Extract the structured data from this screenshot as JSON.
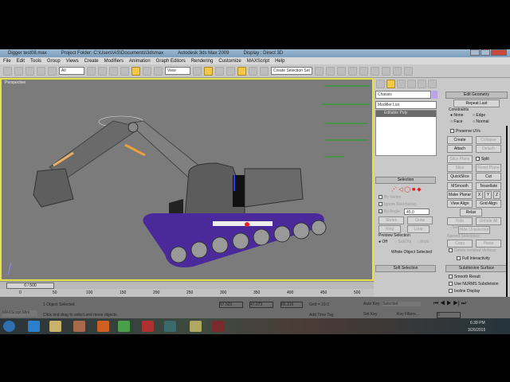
{
  "title": {
    "file": "Digger test08.max",
    "project": "Project Folder: C:\\Users\\AS\\Documents\\3dsmax",
    "app": "Autodesk 3ds Max 2009",
    "display": "Display : Direct 3D"
  },
  "menu": [
    "File",
    "Edit",
    "Tools",
    "Group",
    "Views",
    "Create",
    "Modifiers",
    "Animation",
    "Graph Editors",
    "Rendering",
    "Customize",
    "MAXScript",
    "Help"
  ],
  "toolbar": {
    "filter": "All",
    "refcoord": "View",
    "selset": "Create Selection Set"
  },
  "viewport": {
    "label": "Perspective"
  },
  "panel": {
    "object_name": "Chassis",
    "modifier_list": "Modifier List",
    "stack_item": "Editable Poly",
    "edit_geometry": "Edit Geometry",
    "repeat_last": "Repeat Last",
    "constraints": "Constraints",
    "c_none": "None",
    "c_edge": "Edge",
    "c_face": "Face",
    "c_normal": "Normal",
    "preserve_uvs": "Preserve UVs",
    "create": "Create",
    "collapse": "Collapse",
    "attach": "Attach",
    "detach": "Detach",
    "slice_plane": "Slice Plane",
    "split": "Split",
    "slice": "Slice",
    "reset_plane": "Reset Plane",
    "quickslice": "QuickSlice",
    "cut": "Cut",
    "msmooth": "MSmooth",
    "tessellate": "Tessellate",
    "make_planar": "Make Planar",
    "x": "X",
    "y": "Y",
    "z": "Z",
    "view_align": "View Align",
    "grid_align": "Grid Align",
    "relax": "Relax",
    "hide_selected": "Hide Selected",
    "unhide_all": "Unhide All",
    "hide_unselected": "Hide Unselected",
    "named_selections": "Named Selections:",
    "copy": "Copy",
    "paste": "Paste",
    "delete_isolated": "Delete Isolated Vertices",
    "full_interactivity": "Full Interactivity",
    "subdivision_surface": "Subdivision Surface",
    "smooth_result": "Smooth Result",
    "use_nurms": "Use NURMS Subdivision",
    "isoline_display": "Isoline Display",
    "selection": "Selection",
    "by_vertex": "By Vertex",
    "ignore_backfacing": "Ignore Backfacing",
    "by_angle": "By Angle:",
    "angle_val": "45.0",
    "shrink": "Shrink",
    "grow": "Grow",
    "ring": "Ring",
    "loop": "Loop",
    "preview_selection": "Preview Selection",
    "p_off": "Off",
    "p_subobj": "SubObj",
    "p_multi": "Multi",
    "whole_object": "Whole Object Selected",
    "soft_selection": "Soft Selection"
  },
  "timeline": {
    "frame": "0 / 500",
    "ticks": [
      "0",
      "50",
      "100",
      "150",
      "200",
      "250",
      "300",
      "350",
      "400",
      "450",
      "500"
    ]
  },
  "status": {
    "maxscript": "MAXScript Mini",
    "selected": "1 Object Selected",
    "prompt": "Click and drag to select and move objects",
    "x": "57.503",
    "y": "47.073",
    "z": "65.316",
    "grid": "Grid = 10.0",
    "add_time_tag": "Add Time Tag",
    "auto_key": "Auto Key",
    "set_key": "Set Key",
    "key_mode": "Selected",
    "key_filters": "Key Filters...",
    "frame_field": "0"
  },
  "clock": {
    "time": "6:38 PM",
    "date": "3/26/2015"
  },
  "colors": {
    "viewport_border": "#e7e04a",
    "tracks": "#4a2a9a",
    "obj_color": "#b9a3e8"
  }
}
